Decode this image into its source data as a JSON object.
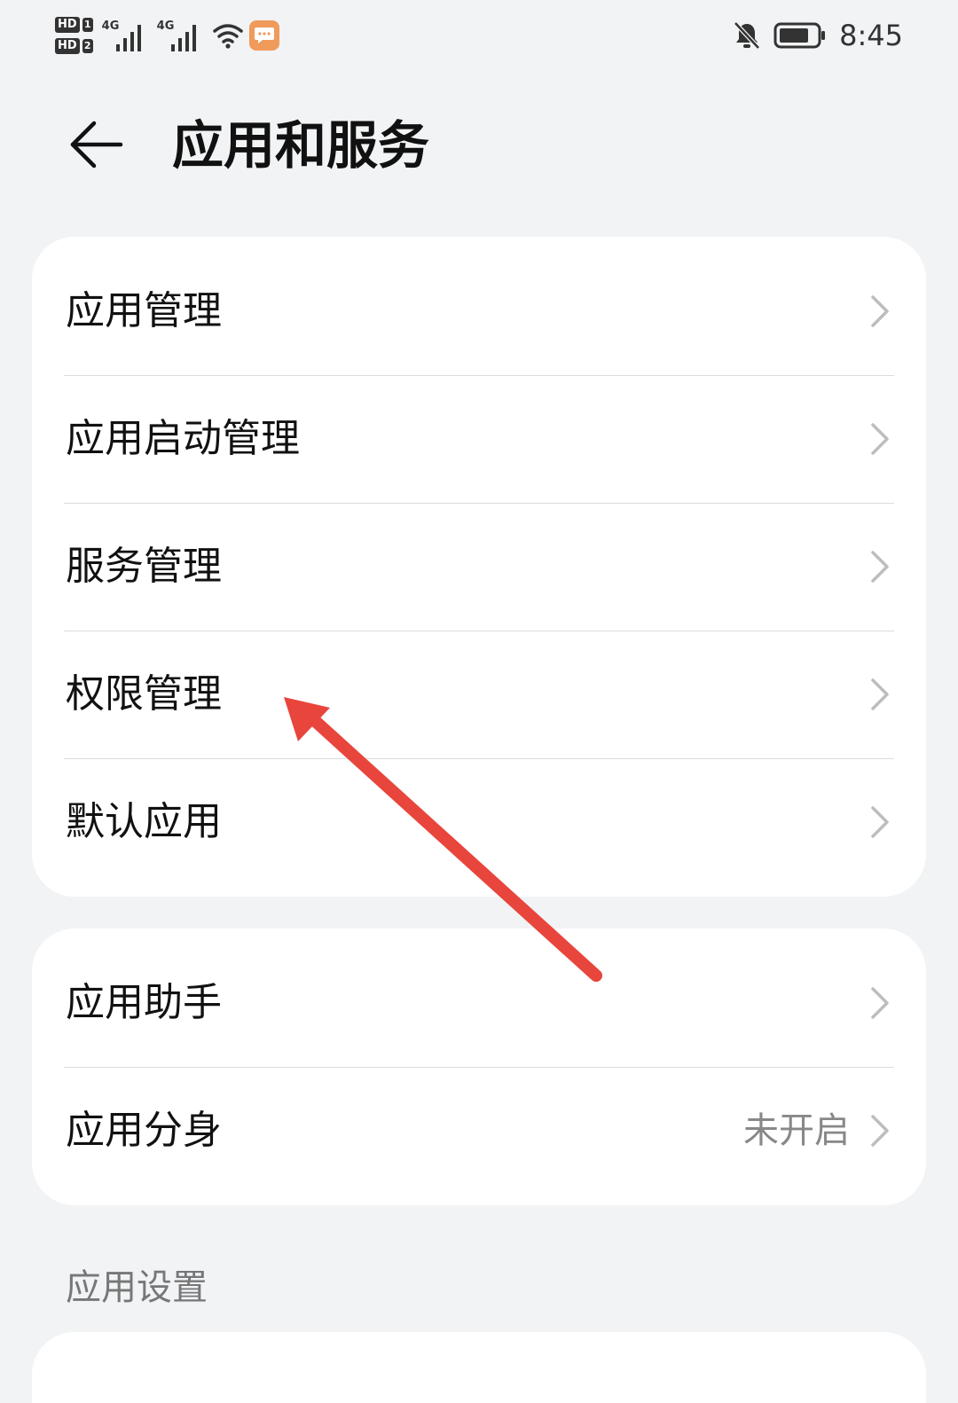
{
  "status_bar": {
    "sim1_badge": "HD",
    "sim1_num": "1",
    "sim2_badge": "HD",
    "sim2_num": "2",
    "net1": "4G",
    "net2": "4G",
    "time": "8:45",
    "icons": [
      "signal-icon",
      "wifi-icon",
      "message-icon",
      "bell-muted-icon",
      "battery-icon"
    ]
  },
  "header": {
    "title": "应用和服务",
    "back_icon": "arrow-left-icon"
  },
  "group1": {
    "items": [
      {
        "label": "应用管理"
      },
      {
        "label": "应用启动管理"
      },
      {
        "label": "服务管理"
      },
      {
        "label": "权限管理"
      },
      {
        "label": "默认应用"
      }
    ]
  },
  "group2": {
    "items": [
      {
        "label": "应用助手",
        "value": ""
      },
      {
        "label": "应用分身",
        "value": "未开启"
      }
    ]
  },
  "section": {
    "label": "应用设置"
  },
  "colors": {
    "background": "#f1f3f5",
    "card": "#ffffff",
    "annotation_arrow": "#e8453c",
    "message_icon": "#f09a5b"
  }
}
